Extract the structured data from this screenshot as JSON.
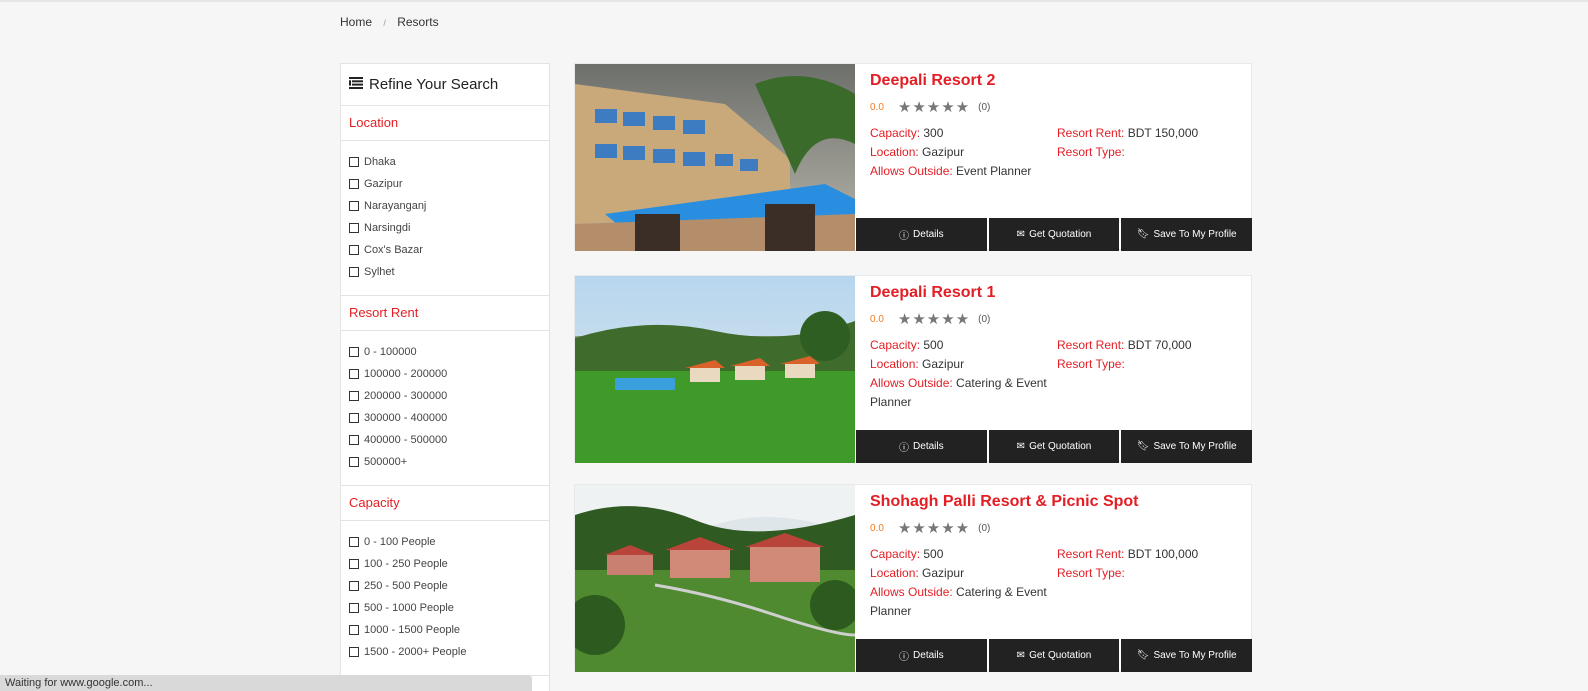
{
  "breadcrumb": {
    "home": "Home",
    "current": "Resorts",
    "separator": "/"
  },
  "sidebar": {
    "title": "Refine Your Search",
    "location": {
      "heading": "Location",
      "items": [
        "Dhaka",
        "Gazipur",
        "Narayanganj",
        "Narsingdi",
        "Cox's Bazar",
        "Sylhet"
      ]
    },
    "rent": {
      "heading": "Resort Rent",
      "items": [
        "0 - 100000",
        "100000 - 200000",
        "200000 - 300000",
        "300000 - 400000",
        "400000 - 500000",
        "500000+"
      ]
    },
    "capacity": {
      "heading": "Capacity",
      "items": [
        "0 - 100 People",
        "100 - 250 People",
        "250 - 500 People",
        "500 - 1000 People",
        "1000 - 1500 People",
        "1500 - 2000+ People"
      ]
    }
  },
  "labels": {
    "capacity": "Capacity:",
    "location": "Location:",
    "allows_outside": "Allows Outside:",
    "rent": "Resort Rent:",
    "type": "Resort Type:",
    "stars": "★★★★★"
  },
  "buttons": {
    "details": "Details",
    "quotation": "Get Quotation",
    "save": "Save To My Profile"
  },
  "resorts": [
    {
      "name": "Deepali Resort 2",
      "score": "0.0",
      "reviews": "(0)",
      "capacity": "300",
      "location": "Gazipur",
      "allows_outside": "Event Planner",
      "rent": "BDT 150,000",
      "type": ""
    },
    {
      "name": "Deepali Resort 1",
      "score": "0.0",
      "reviews": "(0)",
      "capacity": "500",
      "location": "Gazipur",
      "allows_outside": "Catering & Event Planner",
      "rent": "BDT 70,000",
      "type": ""
    },
    {
      "name": "Shohagh Palli Resort & Picnic Spot",
      "score": "0.0",
      "reviews": "(0)",
      "capacity": "500",
      "location": "Gazipur",
      "allows_outside": "Catering & Event Planner",
      "rent": "BDT 100,000",
      "type": ""
    }
  ],
  "status_bar": {
    "text": "Waiting for www.google.com..."
  },
  "colors": {
    "accent": "#e31e24",
    "score": "#f47b20",
    "button_bg": "#222222"
  }
}
